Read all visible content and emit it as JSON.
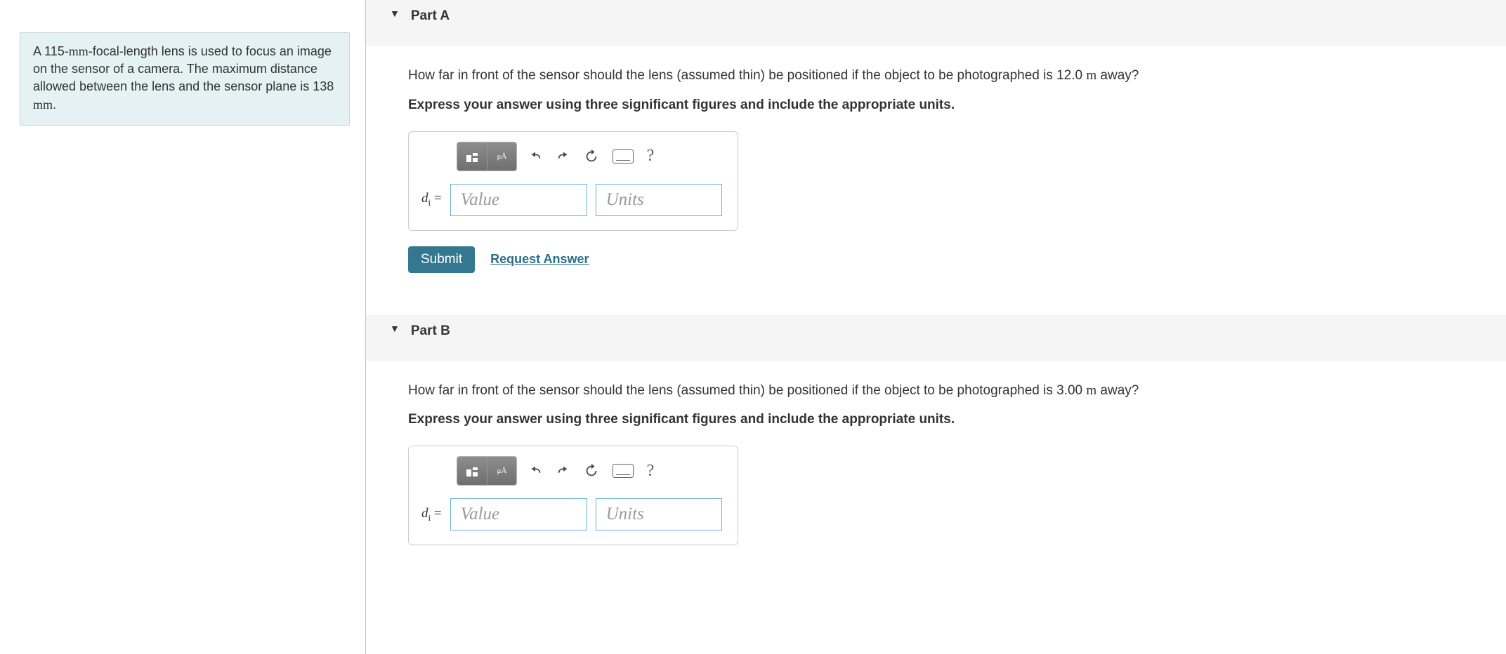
{
  "problem": {
    "text_parts": [
      "A 115-",
      "mm",
      "-focal-length lens is used to focus an image on the sensor of a camera. The maximum distance allowed between the lens and the sensor plane is 138 ",
      "mm",
      "."
    ]
  },
  "parts": [
    {
      "label": "Part A",
      "question_pre": "How far in front of the sensor should the lens (assumed thin) be positioned if the object to be photographed is 12.0 ",
      "question_unit": "m",
      "question_post": " away?",
      "instruction": "Express your answer using three significant figures and include the appropriate units.",
      "variable_base": "d",
      "variable_sub": "i",
      "value_placeholder": "Value",
      "units_placeholder": "Units",
      "submit": "Submit",
      "request": "Request Answer"
    },
    {
      "label": "Part B",
      "question_pre": "How far in front of the sensor should the lens (assumed thin) be positioned if the object to be photographed is 3.00 ",
      "question_unit": "m",
      "question_post": " away?",
      "instruction": "Express your answer using three significant figures and include the appropriate units.",
      "variable_base": "d",
      "variable_sub": "i",
      "value_placeholder": "Value",
      "units_placeholder": "Units",
      "submit": "Submit",
      "request": "Request Answer"
    }
  ],
  "toolbar": {
    "undo": "↶",
    "redo": "↷",
    "reset": "↻",
    "help": "?"
  }
}
